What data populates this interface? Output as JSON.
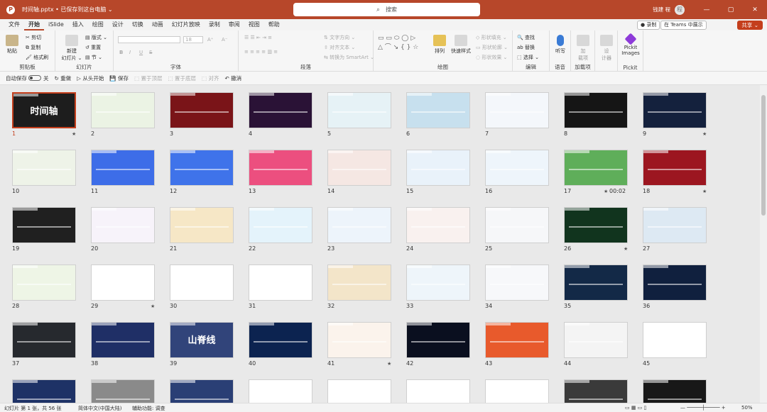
{
  "titlebar": {
    "file_name": "时间轴.pptx • 已保存到这台电脑 ⌄",
    "search_placeholder": "搜索",
    "user": "钱建 程",
    "avatar": "程",
    "min": "—",
    "max": "▢",
    "close": "✕"
  },
  "menu": {
    "tabs": [
      "文件",
      "开始",
      "iSlide",
      "插入",
      "绘图",
      "设计",
      "切换",
      "动画",
      "幻灯片放映",
      "录制",
      "审阅",
      "视图",
      "帮助"
    ]
  },
  "ribbon_right": {
    "record": "● 录制",
    "teams": "在 Teams 中展示",
    "share": "共享 ⌄"
  },
  "ribbon": {
    "clipboard": {
      "label": "剪贴板",
      "paste": "粘贴",
      "cut": "✂ 剪切",
      "copy": "⧉ 复制",
      "format_painter": "🖌 格式刷"
    },
    "slides": {
      "label": "幻灯片",
      "new_slide": "新建\n幻灯片 ⌄",
      "layout": "▤ 版式 ⌄",
      "reset": "↺ 重置",
      "section": "▤ 节 ⌄"
    },
    "font": {
      "label": "字体",
      "font_size": "18",
      "bold": "B",
      "italic": "I",
      "underline": "U",
      "strike": "S",
      "grow": "A⁺",
      "shrink": "A⁻"
    },
    "paragraph": {
      "label": "段落",
      "text_direction": "⇅ 文字方向 ⌄",
      "align_text": "⇳ 对齐文本 ⌄",
      "smartart": "⇆ 转换为 SmartArt ⌄"
    },
    "drawing": {
      "label": "绘图",
      "arrange": "排列",
      "quick_styles": "快速样式",
      "shape_fill": "◇ 形状填充 ⌄",
      "shape_outline": "▭ 形状轮廓 ⌄",
      "shape_effects": "◌ 形状效果 ⌄"
    },
    "editing": {
      "label": "编辑",
      "find": "🔍 查找",
      "replace": "ab 替换",
      "select": "⬚ 选择 ⌄"
    },
    "voice": {
      "label": "语音",
      "dictate": "听写"
    },
    "addins": {
      "label": "加载项",
      "addin": "加\n载项"
    },
    "designer": {
      "label": "",
      "designer": "设\n计器"
    },
    "pickit": {
      "label": "Pickit",
      "pickit": "Pickit\nImages"
    }
  },
  "qat": {
    "autosave": "自动保存",
    "autosave_state": "关",
    "redo": "↻ 重做",
    "from_start": "▷ 从头开始",
    "save": "💾 保存",
    "first_place": "⬚ 置于顶层",
    "send_back": "⬚ 置于底层",
    "align": "⬚ 对齐",
    "undo": "↶ 撤消"
  },
  "slides": [
    {
      "n": "1",
      "bg": "#1d1d1d",
      "star": true,
      "title": "时间轴",
      "sel": true
    },
    {
      "n": "2",
      "bg": "#ebf3e4",
      "star": false
    },
    {
      "n": "3",
      "bg": "#7a1418",
      "star": false
    },
    {
      "n": "4",
      "bg": "#2a1236",
      "star": false
    },
    {
      "n": "5",
      "bg": "#e6f2f6",
      "star": false
    },
    {
      "n": "6",
      "bg": "#c7e0ee",
      "star": false
    },
    {
      "n": "7",
      "bg": "#f4f7fb",
      "star": false
    },
    {
      "n": "8",
      "bg": "#151515",
      "star": false
    },
    {
      "n": "9",
      "bg": "#14213d",
      "star": true
    },
    {
      "n": "10",
      "bg": "#eef3e8",
      "star": false
    },
    {
      "n": "11",
      "bg": "#3d6de8",
      "star": false
    },
    {
      "n": "12",
      "bg": "#3f73ea",
      "star": false
    },
    {
      "n": "13",
      "bg": "#ec4f7f",
      "star": false
    },
    {
      "n": "14",
      "bg": "#f5e7e3",
      "star": false
    },
    {
      "n": "15",
      "bg": "#e9f2fa",
      "star": false
    },
    {
      "n": "16",
      "bg": "#eef5fb",
      "star": false
    },
    {
      "n": "17",
      "bg": "#5fae5a",
      "star": true,
      "timing": "00:02"
    },
    {
      "n": "18",
      "bg": "#9c1620",
      "star": true
    },
    {
      "n": "19",
      "bg": "#202020",
      "star": false
    },
    {
      "n": "20",
      "bg": "#f7f3fa",
      "star": false
    },
    {
      "n": "21",
      "bg": "#f6e7c6",
      "star": false
    },
    {
      "n": "22",
      "bg": "#e4f3fb",
      "star": false
    },
    {
      "n": "23",
      "bg": "#edf4fb",
      "star": false
    },
    {
      "n": "24",
      "bg": "#f9f1ef",
      "star": false
    },
    {
      "n": "25",
      "bg": "#f6f7f9",
      "star": false
    },
    {
      "n": "26",
      "bg": "#11341e",
      "star": true
    },
    {
      "n": "27",
      "bg": "#dde9f3",
      "star": false
    },
    {
      "n": "28",
      "bg": "#eef5e6",
      "star": false
    },
    {
      "n": "29",
      "bg": "#ffffff",
      "star": true
    },
    {
      "n": "30",
      "bg": "#ffffff",
      "star": false
    },
    {
      "n": "31",
      "bg": "#ffffff",
      "star": false
    },
    {
      "n": "32",
      "bg": "#f3e5c9",
      "star": false
    },
    {
      "n": "33",
      "bg": "#eef5fa",
      "star": false
    },
    {
      "n": "34",
      "bg": "#f7f8fa",
      "star": false
    },
    {
      "n": "35",
      "bg": "#132947",
      "star": false
    },
    {
      "n": "36",
      "bg": "#10203e",
      "star": false
    },
    {
      "n": "37",
      "bg": "#26292e",
      "star": false
    },
    {
      "n": "38",
      "bg": "#1f2f66",
      "star": false
    },
    {
      "n": "39",
      "bg": "#31447a",
      "star": false,
      "title": "山脊线"
    },
    {
      "n": "40",
      "bg": "#0c2350",
      "star": false
    },
    {
      "n": "41",
      "bg": "#fbf3ec",
      "star": true
    },
    {
      "n": "42",
      "bg": "#0a0f1f",
      "star": false
    },
    {
      "n": "43",
      "bg": "#e85a2c",
      "star": false
    },
    {
      "n": "44",
      "bg": "#f4f4f4",
      "star": false
    },
    {
      "n": "45",
      "bg": "#ffffff",
      "star": false
    },
    {
      "n": "46",
      "bg": "#1e3266",
      "star": false
    },
    {
      "n": "47",
      "bg": "#8a8a8a",
      "star": false
    },
    {
      "n": "48",
      "bg": "#2a3f75",
      "star": false
    },
    {
      "n": "49",
      "bg": "#ffffff",
      "star": false
    },
    {
      "n": "50",
      "bg": "#ffffff",
      "star": false
    },
    {
      "n": "51",
      "bg": "#ffffff",
      "star": false
    },
    {
      "n": "52",
      "bg": "#ffffff",
      "star": false
    },
    {
      "n": "53",
      "bg": "#3a3a3a",
      "star": false
    },
    {
      "n": "54",
      "bg": "#181818",
      "star": false
    }
  ],
  "status": {
    "slide_count": "幻灯片 第 1 张，共 56 张",
    "language": "简体中文(中国大陆)",
    "accessibility": "辅助功能: 调查",
    "zoom": "50%"
  }
}
